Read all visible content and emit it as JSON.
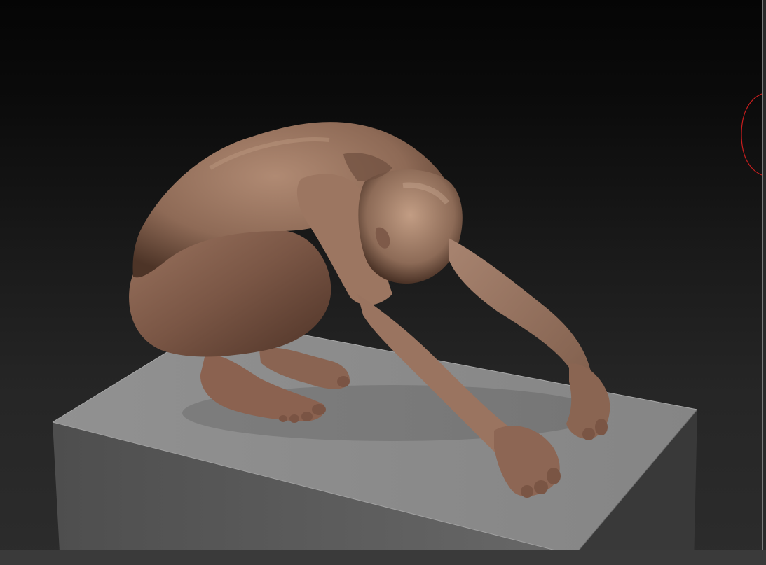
{
  "app": {
    "view": "3d-viewport"
  },
  "scene": {
    "model": "crouching-human-figure",
    "base": "box-pedestal",
    "colors": {
      "skin": "#9a7560",
      "skin_shadow": "#5a3e2f",
      "skin_highlight": "#c8a48c",
      "box_top": "#8a8a8a",
      "box_front": "#5e5e5e",
      "box_side": "#3a3a3a",
      "background_top": "#050505",
      "background_bottom": "#2c2c2c",
      "gizmo": "#c81e1e"
    }
  },
  "gizmo": {
    "icon": "rotation-gizmo-icon"
  }
}
